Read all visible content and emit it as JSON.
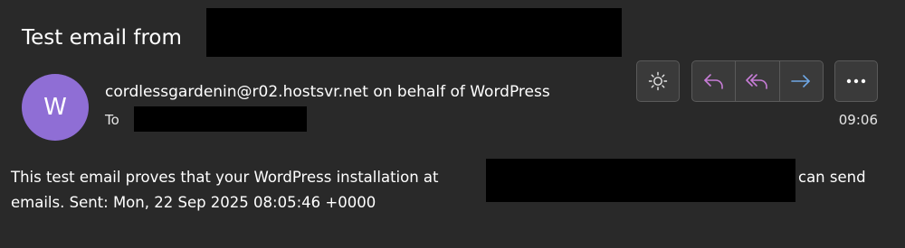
{
  "subject": {
    "text": "Test email from"
  },
  "sender": {
    "avatar_initial": "W",
    "avatar_color": "#8f6ed5",
    "from_line": "cordlessgardenin@r02.hostsvr.net on behalf of WordPress",
    "to_label": "To",
    "time": "09:06"
  },
  "toolbar": {
    "icons": [
      "brightness-icon",
      "reply-icon",
      "reply-all-icon",
      "forward-icon",
      "more-icon"
    ],
    "reply_color": "#c77dd7",
    "forward_color": "#6fa8e6"
  },
  "body": {
    "line1_start": "This test email proves that your WordPress installation at",
    "line1_end": "can send",
    "line2": "emails. Sent: Mon, 22 Sep 2025 08:05:46 +0000"
  }
}
